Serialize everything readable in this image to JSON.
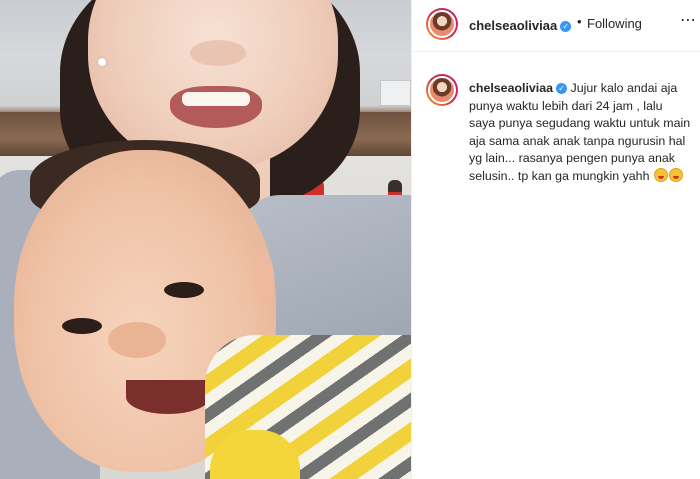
{
  "post": {
    "photo": {
      "alt_icon": "photo-of-mother-and-baby"
    },
    "header": {
      "username": "chelseaoliviaa",
      "verified_icon": "verified-badge-icon",
      "separator": "•",
      "follow_status": "Following",
      "more_icon": "more-options-icon",
      "more_glyph": "⋯"
    },
    "caption": {
      "username": "chelseaoliviaa",
      "text": "Jujur kalo andai aja punya waktu lebih dari 24 jam , lalu saya punya segudang waktu untuk main aja sama anak anak tanpa ngurusin hal yg lain... rasanya pengen punya anak selusin.. tp kan ga mungkin yahh",
      "emojis": [
        "grinning-squinting-face",
        "grinning-squinting-face"
      ]
    },
    "colors": {
      "verified": "#3897f0",
      "text": "#262626",
      "border": "#efefef"
    }
  }
}
